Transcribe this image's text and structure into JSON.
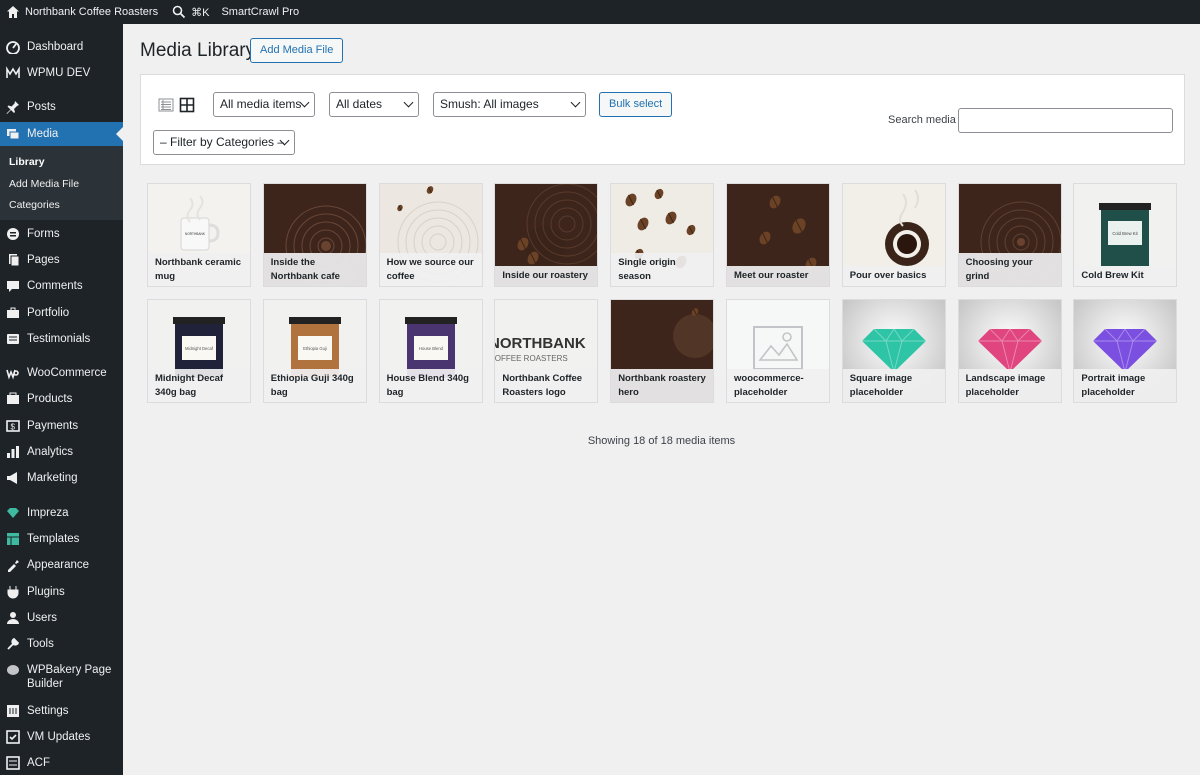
{
  "admin_bar": {
    "site_name": "Northbank Coffee Roasters",
    "shortcut": "⌘K",
    "plugin": "SmartCrawl Pro"
  },
  "sidebar": {
    "items": [
      {
        "label": "Dashboard",
        "icon": "dashboard-icon"
      },
      {
        "label": "WPMU DEV",
        "icon": "wpmudev-icon"
      },
      {
        "label": "Posts",
        "icon": "pin-icon"
      },
      {
        "label": "Media",
        "icon": "media-icon",
        "active": true
      },
      {
        "label": "Forms",
        "icon": "forms-icon"
      },
      {
        "label": "Pages",
        "icon": "pages-icon"
      },
      {
        "label": "Comments",
        "icon": "comments-icon"
      },
      {
        "label": "Portfolio",
        "icon": "portfolio-icon"
      },
      {
        "label": "Testimonials",
        "icon": "testimonials-icon"
      },
      {
        "label": "WooCommerce",
        "icon": "woo-icon"
      },
      {
        "label": "Products",
        "icon": "products-icon"
      },
      {
        "label": "Payments",
        "icon": "payments-icon"
      },
      {
        "label": "Analytics",
        "icon": "analytics-icon"
      },
      {
        "label": "Marketing",
        "icon": "marketing-icon"
      },
      {
        "label": "Impreza",
        "icon": "impreza-icon"
      },
      {
        "label": "Templates",
        "icon": "templates-icon"
      },
      {
        "label": "Appearance",
        "icon": "appearance-icon"
      },
      {
        "label": "Plugins",
        "icon": "plugins-icon"
      },
      {
        "label": "Users",
        "icon": "users-icon"
      },
      {
        "label": "Tools",
        "icon": "tools-icon"
      },
      {
        "label": "WPBakery Page Builder",
        "icon": "wpbakery-icon"
      },
      {
        "label": "Settings",
        "icon": "settings-icon"
      },
      {
        "label": "VM Updates",
        "icon": "vm-updates-icon"
      },
      {
        "label": "ACF",
        "icon": "acf-icon"
      }
    ],
    "submenu": [
      "Library",
      "Add Media File",
      "Categories"
    ]
  },
  "page": {
    "title": "Media Library",
    "add_button": "Add Media File"
  },
  "filters": {
    "media_type": "All media items",
    "dates": "All dates",
    "smush": "Smush: All images",
    "bulk_select": "Bulk select",
    "categories": "– Filter by Categories –",
    "search_label": "Search media",
    "search_value": ""
  },
  "media": [
    {
      "title": "Northbank ceramic mug"
    },
    {
      "title": "Inside the Northbank cafe"
    },
    {
      "title": "How we source our coffee"
    },
    {
      "title": "Inside our roastery"
    },
    {
      "title": "Single origin season"
    },
    {
      "title": "Meet our roaster"
    },
    {
      "title": "Pour over basics"
    },
    {
      "title": "Choosing your grind"
    },
    {
      "title": "Cold Brew Kit",
      "label_text": "Cold Brew Kit"
    },
    {
      "title": "Midnight Decaf 340g bag",
      "label_text": "Midnight Decaf"
    },
    {
      "title": "Ethiopia Guji 340g bag",
      "label_text": "Ethiopia Guji"
    },
    {
      "title": "House Blend 340g bag",
      "label_text": "House Blend"
    },
    {
      "title": "Northbank Coffee Roasters logo",
      "logo_main": "NORTHBANK",
      "logo_sub": "COFFEE ROASTERS"
    },
    {
      "title": "Northbank roastery hero"
    },
    {
      "title": "woocommerce-placeholder"
    },
    {
      "title": "Square image placeholder"
    },
    {
      "title": "Landscape image placeholder"
    },
    {
      "title": "Portrait image placeholder"
    }
  ],
  "colors": {
    "accent": "#2271b1",
    "sidebar_bg": "#1d2327",
    "gem_teal": "#2ec4a6",
    "gem_pink": "#e0457f",
    "gem_purple": "#7b4fe0"
  },
  "status": "Showing 18 of 18 media items"
}
